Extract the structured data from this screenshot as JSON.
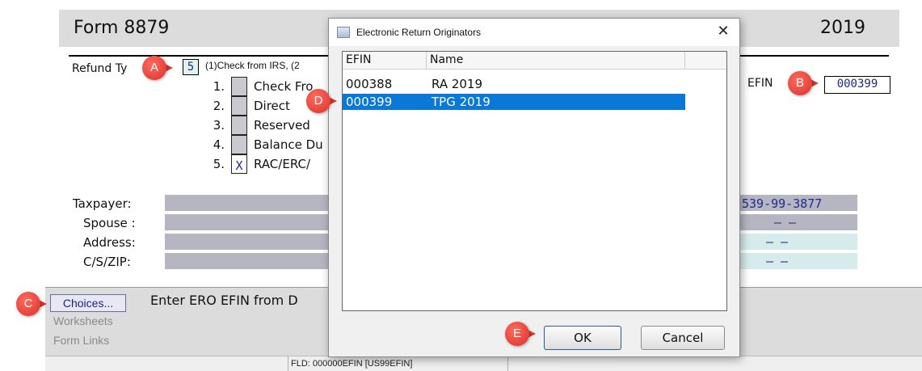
{
  "form": {
    "title": "Form 8879",
    "year": "2019",
    "refund_type_label": "Refund Ty",
    "refund_type_value": "5",
    "refund_type_desc": "(1)Check from IRS, (2",
    "options": [
      {
        "num": "1.",
        "value": "",
        "text": "Check Fro"
      },
      {
        "num": "2.",
        "value": "",
        "text": "Direct"
      },
      {
        "num": "3.",
        "value": "",
        "text": "Reserved"
      },
      {
        "num": "4.",
        "value": "",
        "text": "Balance Du"
      },
      {
        "num": "5.",
        "value": "X",
        "text": "RAC/ERC/"
      }
    ],
    "efin_label": "EFIN",
    "efin_value": "000399",
    "people": [
      {
        "label": "Taxpayer:",
        "ssn": "539-99-3877"
      },
      {
        "label": "Spouse :",
        "ssn": "–  –"
      },
      {
        "label": "Address:",
        "ssn": "–  –"
      },
      {
        "label": "C/S/ZIP:",
        "ssn": "–  –"
      }
    ]
  },
  "bottom": {
    "choices_label": "Choices...",
    "worksheets_label": "Worksheets",
    "form_links_label": "Form Links",
    "enter_text": "Enter ERO EFIN from D",
    "status_text": "FLD: 000000EFIN  [US99EFIN]"
  },
  "dialog": {
    "title": "Electronic Return Originators",
    "columns": [
      "EFIN",
      "Name"
    ],
    "rows": [
      {
        "efin": "000388",
        "name": "RA 2019",
        "selected": false
      },
      {
        "efin": "000399",
        "name": "TPG 2019",
        "selected": true
      }
    ],
    "ok_label": "OK",
    "cancel_label": "Cancel"
  },
  "callouts": {
    "a": "A",
    "b": "B",
    "c": "C",
    "d": "D",
    "e": "E"
  },
  "colors": {
    "selection": "#0a78d7",
    "callout": "#d9302a",
    "field_text": "#1f2a8a"
  }
}
